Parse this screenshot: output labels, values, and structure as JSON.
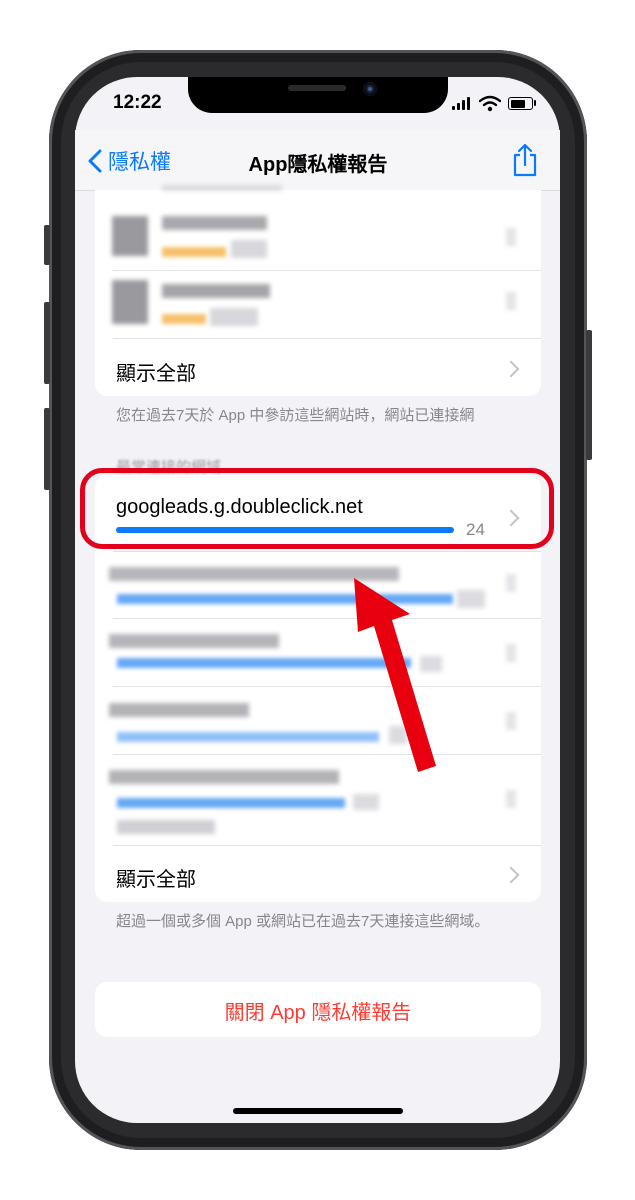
{
  "status_bar": {
    "time": "12:22",
    "battery_level": 0.75
  },
  "nav": {
    "back_label": "隱私權",
    "title": "App隱私權報告",
    "share_icon": "share-icon"
  },
  "apps_card": {
    "show_all_label": "顯示全部"
  },
  "apps_footnote": "您在過去7天於 App 中參訪這些網站時，網站已連接網",
  "domains_section_header": "最常連接的網域",
  "domains": [
    {
      "name": "googleads.g.doubleclick.net",
      "count": "24",
      "fraction": 1.0
    }
  ],
  "domains_card": {
    "show_all_label": "顯示全部"
  },
  "domains_footnote": "超過一個或多個 App 或網站已在過去7天連接這些網域。",
  "close_report_label": "關閉 App 隱私權報告",
  "colors": {
    "accent": "#0a7aff",
    "destructive": "#ff3b30",
    "highlight": "#e3001b",
    "arrow": "#e8000e"
  }
}
